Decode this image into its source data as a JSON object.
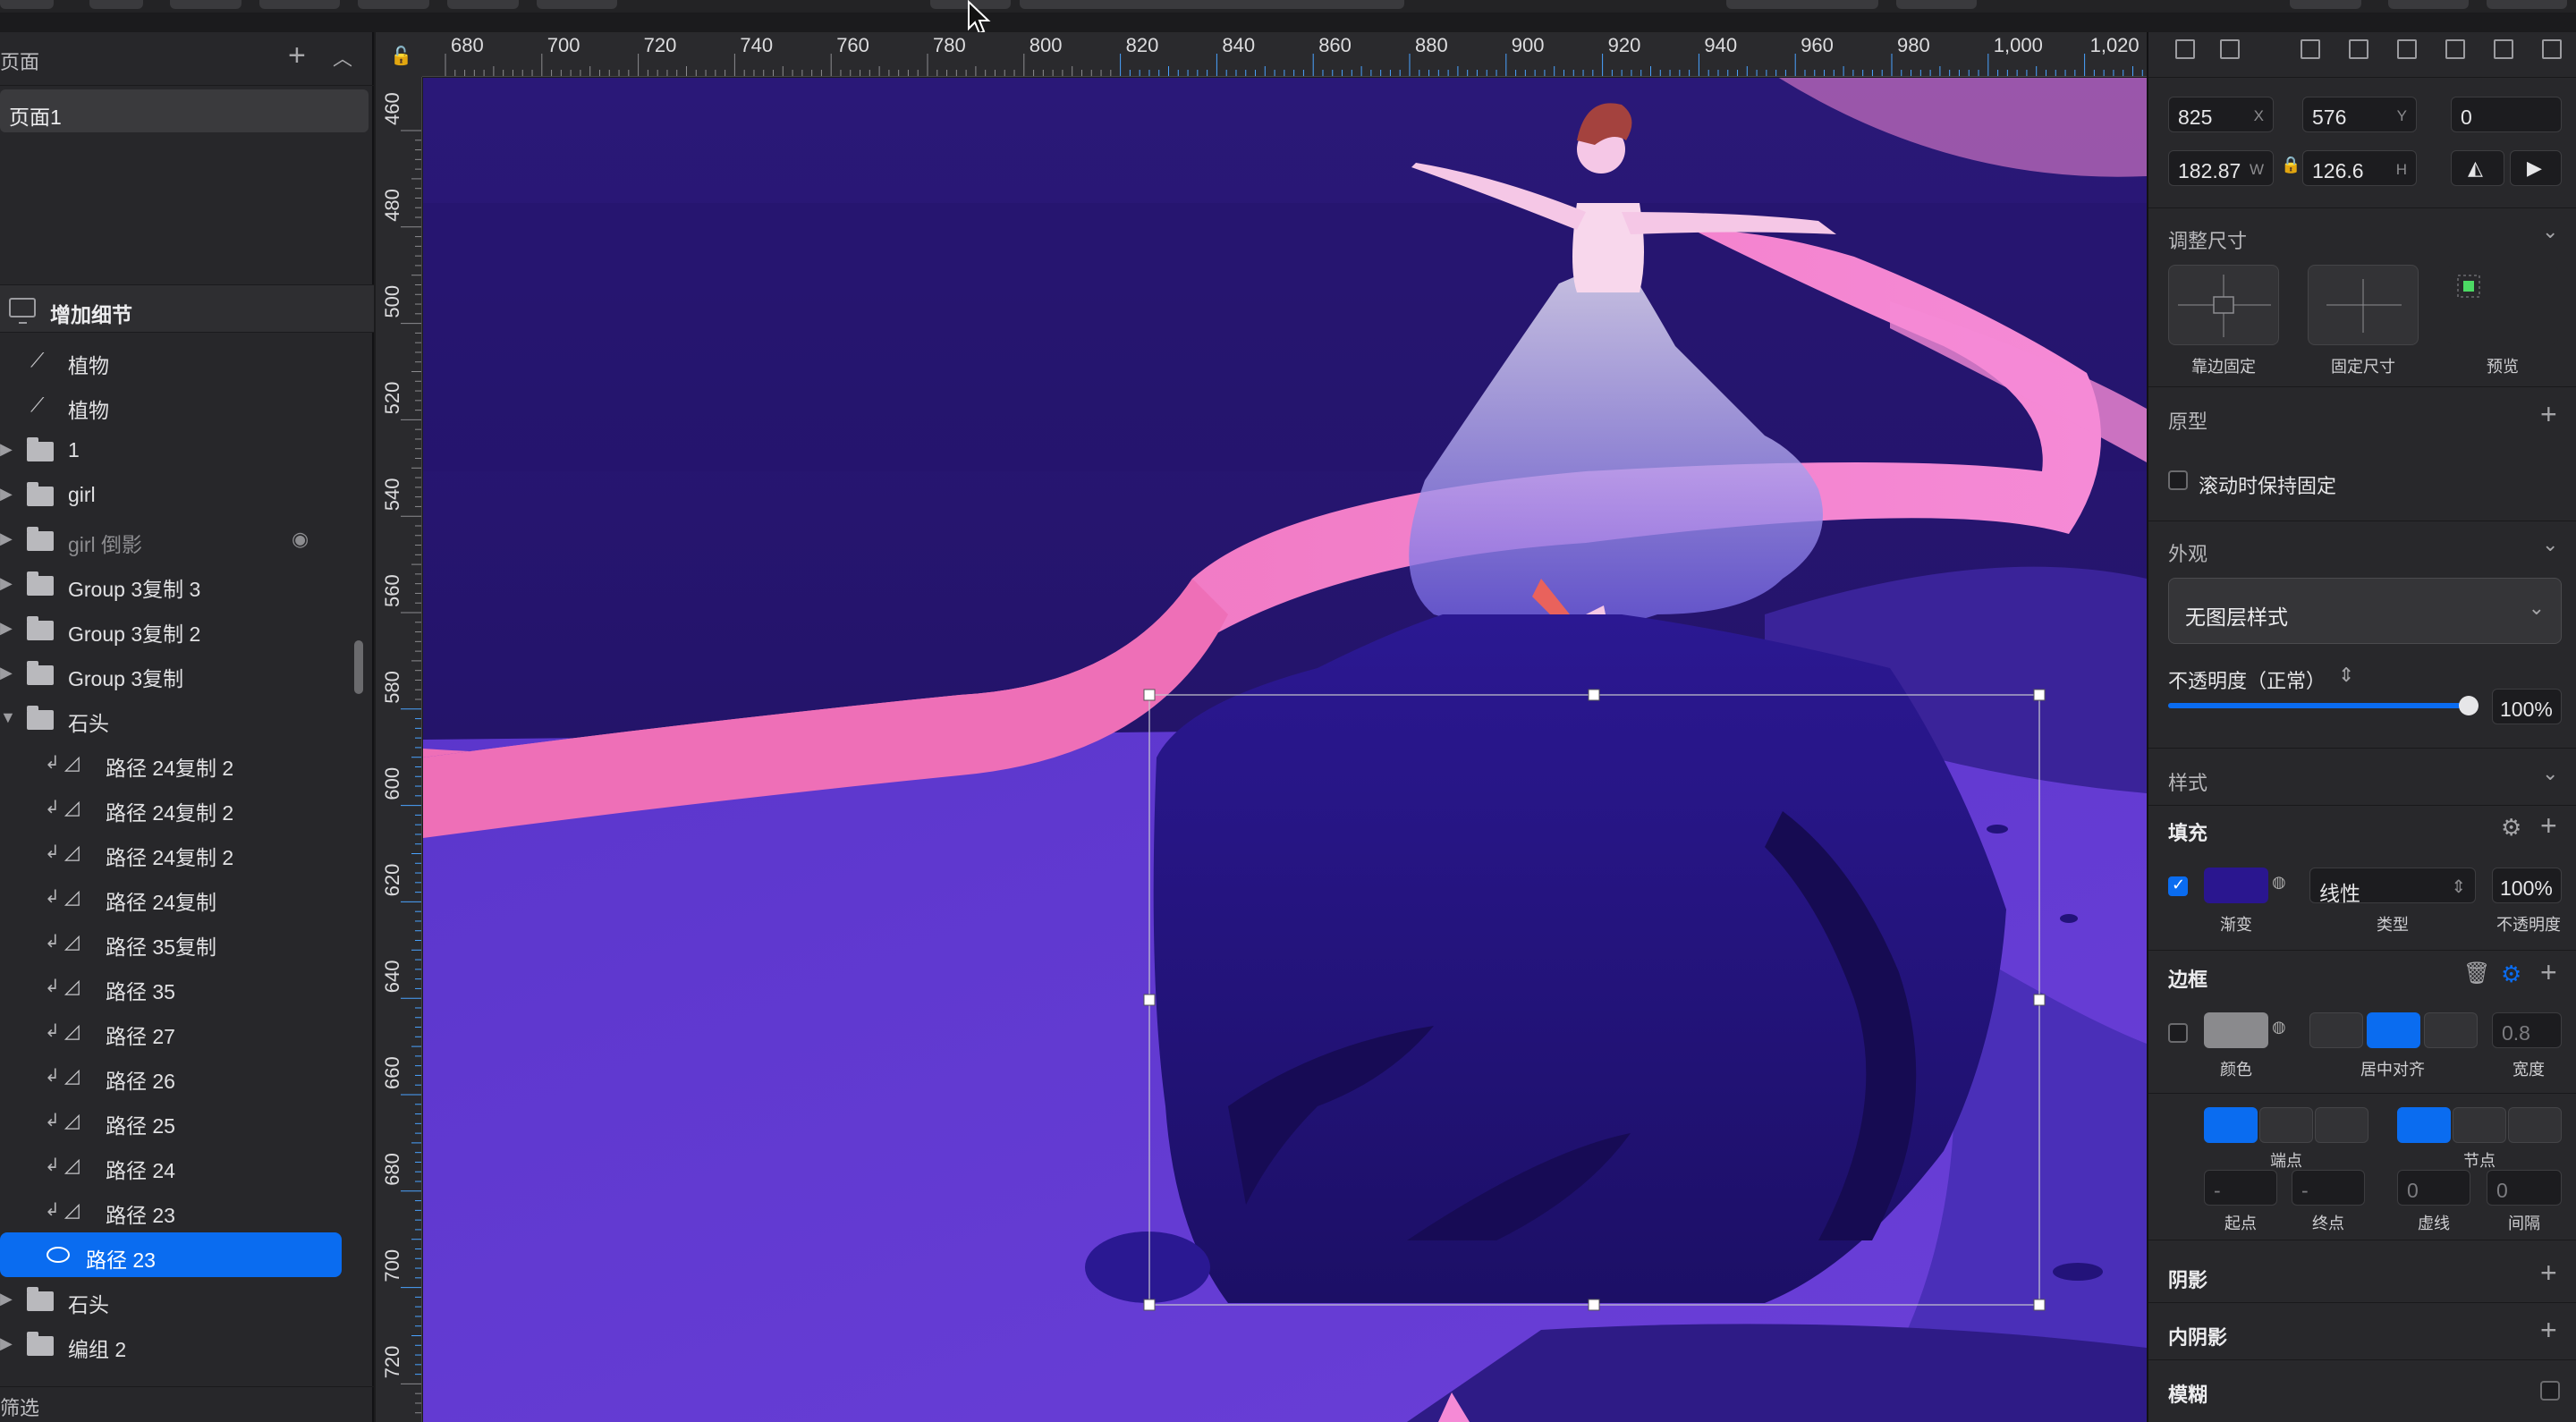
{
  "layers_panel": {
    "pages_title": "页面",
    "add_glyph": "+",
    "collapse_glyph": "︿",
    "page_item": "页面1",
    "artboard": "增加细节",
    "rows": [
      {
        "name": "植物",
        "kind": "path",
        "indent": 1
      },
      {
        "name": "植物",
        "kind": "path",
        "indent": 1
      },
      {
        "name": "1",
        "kind": "folder",
        "indent": 0
      },
      {
        "name": "girl",
        "kind": "folder",
        "indent": 0
      },
      {
        "name": "girl 倒影",
        "kind": "folder",
        "indent": 0,
        "hidden": true
      },
      {
        "name": "Group 3复制 3",
        "kind": "folder",
        "indent": 0
      },
      {
        "name": "Group 3复制 2",
        "kind": "folder",
        "indent": 0
      },
      {
        "name": "Group 3复制",
        "kind": "folder",
        "indent": 0
      },
      {
        "name": "石头",
        "kind": "folder-open",
        "indent": 0
      },
      {
        "name": "路径 24复制 2",
        "kind": "mask-path",
        "indent": 1
      },
      {
        "name": "路径 24复制 2",
        "kind": "mask-path",
        "indent": 1
      },
      {
        "name": "路径 24复制 2",
        "kind": "mask-path",
        "indent": 1
      },
      {
        "name": "路径 24复制",
        "kind": "mask-path",
        "indent": 1
      },
      {
        "name": "路径 35复制",
        "kind": "mask-path",
        "indent": 1
      },
      {
        "name": "路径 35",
        "kind": "mask-path",
        "indent": 1
      },
      {
        "name": "路径 27",
        "kind": "mask-path",
        "indent": 1
      },
      {
        "name": "路径 26",
        "kind": "mask-path",
        "indent": 1
      },
      {
        "name": "路径 25",
        "kind": "mask-path",
        "indent": 1
      },
      {
        "name": "路径 24",
        "kind": "mask-path",
        "indent": 1
      },
      {
        "name": "路径 23",
        "kind": "mask-path",
        "indent": 1
      },
      {
        "name": "路径 23",
        "kind": "selected",
        "indent": 1
      },
      {
        "name": "石头",
        "kind": "folder",
        "indent": 0
      },
      {
        "name": "编组 2",
        "kind": "folder",
        "indent": 0
      }
    ],
    "filter_label": "筛选"
  },
  "ruler": {
    "lock_glyph": "🔓",
    "top_labels": [
      "680",
      "700",
      "720",
      "740",
      "760",
      "780",
      "800",
      "820",
      "840",
      "860",
      "880",
      "900",
      "920",
      "940",
      "960",
      "980",
      "1,000",
      "1,020"
    ],
    "left_labels": [
      "460",
      "480",
      "500",
      "520",
      "540",
      "560",
      "580",
      "600",
      "620",
      "640",
      "660",
      "680",
      "700",
      "720"
    ]
  },
  "inspector": {
    "x": {
      "value": "825",
      "unit": "X"
    },
    "y": {
      "value": "576",
      "unit": "Y"
    },
    "rotation": {
      "value": "0"
    },
    "w": {
      "value": "182.87",
      "unit": "W"
    },
    "h": {
      "value": "126.6",
      "unit": "H"
    },
    "resize_title": "调整尺寸",
    "resize_options": [
      "靠边固定",
      "固定尺寸",
      "预览"
    ],
    "prototype_title": "原型",
    "fix_on_scroll": "滚动时保持固定",
    "appearance_title": "外观",
    "layer_style": "无图层样式",
    "opacity_label": "不透明度（正常）",
    "opacity_value": "100%",
    "opacity_level": 1.0,
    "style_title": "样式",
    "fill_title": "填充",
    "fill": {
      "type": "线性",
      "opacity": "100%",
      "labels": [
        "渐变",
        "类型",
        "不透明度"
      ],
      "color": "#2a168f",
      "enabled": true
    },
    "border_title": "边框",
    "border": {
      "width": "0.8",
      "labels": [
        "颜色",
        "居中对齐",
        "宽度"
      ],
      "color": "#8a8a8d",
      "enabled": false
    },
    "endpoints_label": "端点",
    "nodes_label": "节点",
    "dash_fields": {
      "start": "-",
      "end": "-",
      "dash": "0",
      "gap": "0",
      "labels": [
        "起点",
        "终点",
        "虚线",
        "间隔"
      ]
    },
    "shadow_title": "阴影",
    "inner_shadow_title": "内阴影",
    "blur_title": "模糊",
    "chevron": "⌄",
    "plus": "+"
  },
  "colors": {
    "accent": "#0a6cf0",
    "sky": "#27166f",
    "sea": "#5a38c8",
    "ribbon": "#f27ac9"
  }
}
